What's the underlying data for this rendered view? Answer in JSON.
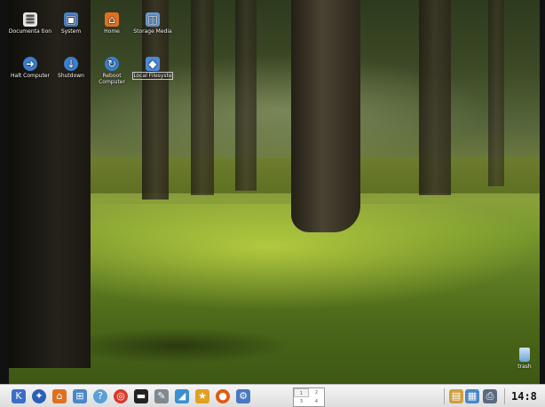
{
  "desktop_icons": [
    {
      "label": "Documenta tion",
      "icon": "document-icon",
      "color": "#e8e8e8"
    },
    {
      "label": "System",
      "icon": "computer-icon",
      "color": "#4a82c8"
    },
    {
      "label": "Home",
      "icon": "home-icon",
      "color": "#e07020"
    },
    {
      "label": "Storage Media",
      "icon": "storage-icon",
      "color": "#6a9ad0"
    },
    {
      "label": "Halt Computer",
      "icon": "halt-icon",
      "color": "#3a7fd0"
    },
    {
      "label": "Shutdown",
      "icon": "shutdown-icon",
      "color": "#3a7fd0"
    },
    {
      "label": "Reboot Computer",
      "icon": "reboot-icon",
      "color": "#3a7fd0"
    },
    {
      "label": "Local Filesyste",
      "icon": "filesystem-icon",
      "color": "#4a8ad8"
    }
  ],
  "trash": {
    "label": "trash"
  },
  "taskbar": {
    "launchers": [
      {
        "icon": "k-menu-icon",
        "color": "#3a6fc8"
      },
      {
        "icon": "konqueror-icon",
        "color": "#2a60b8"
      },
      {
        "icon": "home-folder-icon",
        "color": "#e07020"
      },
      {
        "icon": "network-icon",
        "color": "#4a88c8"
      },
      {
        "icon": "help-icon",
        "color": "#5aa0d8"
      },
      {
        "icon": "lifebuoy-icon",
        "color": "#d83a2a"
      },
      {
        "icon": "terminal-icon",
        "color": "#222222"
      },
      {
        "icon": "editor-icon",
        "color": "#808890"
      },
      {
        "icon": "paint-icon",
        "color": "#3a90d0"
      },
      {
        "icon": "wizard-icon",
        "color": "#e0a020"
      },
      {
        "icon": "firefox-icon",
        "color": "#e05a10"
      },
      {
        "icon": "settings-icon",
        "color": "#4a78c0"
      }
    ],
    "pager": {
      "desktops": [
        "1",
        "2",
        "3",
        "4"
      ],
      "active": "1"
    },
    "tray": [
      {
        "icon": "clipboard-icon",
        "color": "#d0a040"
      },
      {
        "icon": "network-tray-icon",
        "color": "#4a88c8"
      },
      {
        "icon": "printer-icon",
        "color": "#5a6a80"
      }
    ],
    "clock": "14:8"
  }
}
